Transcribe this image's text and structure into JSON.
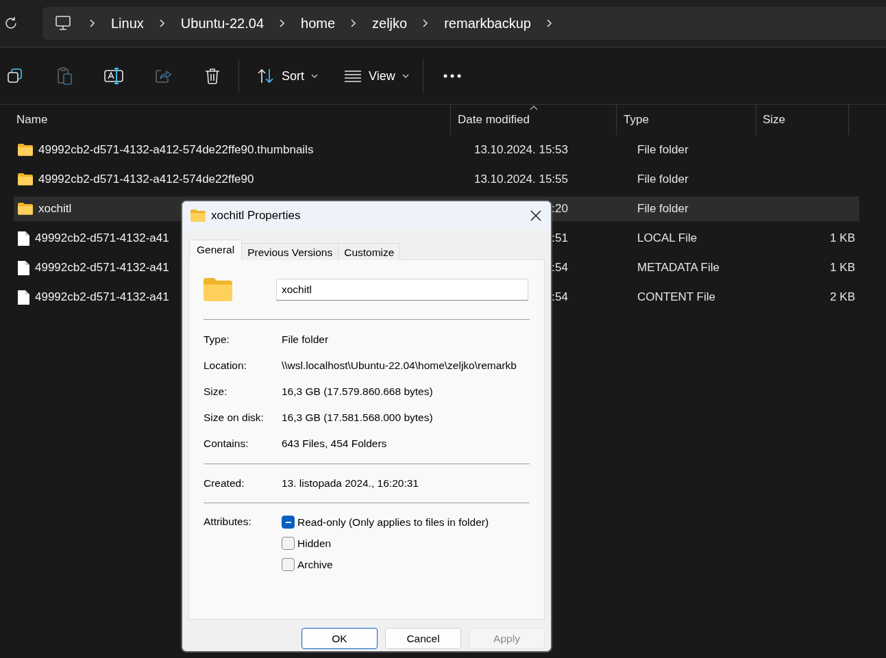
{
  "breadcrumb": [
    "Linux",
    "Ubuntu-22.04",
    "home",
    "zeljko",
    "remarkbackup"
  ],
  "toolbar": {
    "icon_buttons": [
      {
        "kind": "copy",
        "disabled": false
      },
      {
        "kind": "paste",
        "disabled": true
      },
      {
        "kind": "rename",
        "disabled": false
      },
      {
        "kind": "share",
        "disabled": true
      },
      {
        "kind": "delete",
        "disabled": false
      }
    ],
    "sort": "Sort",
    "view": "View"
  },
  "columns": [
    {
      "label": "Name",
      "sorted": false
    },
    {
      "label": "Date modified",
      "sorted": true
    },
    {
      "label": "Type",
      "sorted": false
    },
    {
      "label": "Size",
      "sorted": false
    }
  ],
  "rows": [
    {
      "kind": "folder",
      "name": "49992cb2-d571-4132-a412-574de22ffe90.thumbnails",
      "date": "13.10.2024. 15:53",
      "type": "File folder",
      "selected": false
    },
    {
      "kind": "folder",
      "name": "49992cb2-d571-4132-a412-574de22ffe90",
      "date": "13.10.2024. 15:55",
      "type": "File folder",
      "selected": false
    },
    {
      "kind": "folder",
      "name": "xochitl",
      "date": ":20",
      "type": "File folder",
      "selected": true
    },
    {
      "kind": "file",
      "name": "49992cb2-d571-4132-a41",
      "date": ":51",
      "type": "LOCAL File",
      "size": "1 KB",
      "selected": false
    },
    {
      "kind": "file",
      "name": "49992cb2-d571-4132-a41",
      "date": ":54",
      "type": "METADATA File",
      "size": "1 KB",
      "selected": false
    },
    {
      "kind": "file",
      "name": "49992cb2-d571-4132-a41",
      "date": ":54",
      "type": "CONTENT File",
      "size": "2 KB",
      "selected": false
    }
  ],
  "dialog": {
    "title": "xochitl Properties",
    "tabs": [
      {
        "label": "General",
        "selected": true
      },
      {
        "label": "Previous Versions",
        "selected": false
      },
      {
        "label": "Customize",
        "selected": false
      }
    ],
    "name_value": "xochitl",
    "info": [
      {
        "label": "Type:",
        "value": "File folder"
      },
      {
        "label": "Location:",
        "value": "\\\\wsl.localhost\\Ubuntu-22.04\\home\\zeljko\\remarkb"
      },
      {
        "label": "Size:",
        "value": "16,3 GB (17.579.860.668 bytes)"
      },
      {
        "label": "Size on disk:",
        "value": "16,3 GB (17.581.568.000 bytes)"
      },
      {
        "label": "Contains:",
        "value": "643 Files, 454 Folders"
      }
    ],
    "created": {
      "label": "Created:",
      "value": "13. listopada 2024., 16:20:31"
    },
    "attributes_label": "Attributes:",
    "attributes": [
      {
        "label": "Read-only (Only applies to files in folder)",
        "checked": true,
        "indeterminate": true
      },
      {
        "label": "Hidden",
        "checked": false,
        "indeterminate": false
      },
      {
        "label": "Archive",
        "checked": false,
        "indeterminate": false
      }
    ],
    "buttons": [
      {
        "label": "OK",
        "kind": "default",
        "disabled": false
      },
      {
        "label": "Cancel",
        "kind": "normal",
        "disabled": false
      },
      {
        "label": "Apply",
        "kind": "normal",
        "disabled": true
      }
    ]
  }
}
